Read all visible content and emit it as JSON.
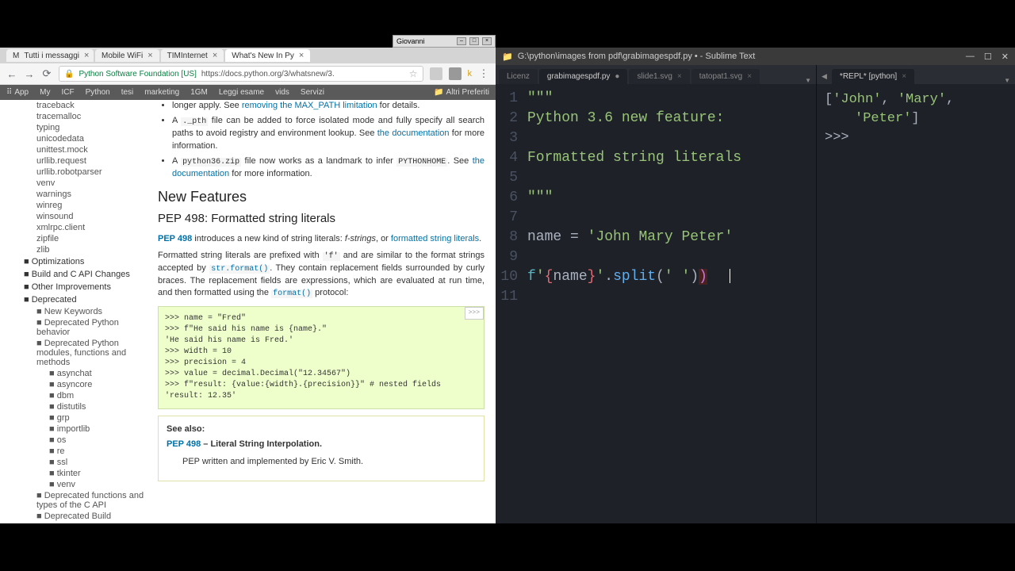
{
  "os_window": {
    "title": "Giovanni"
  },
  "chrome": {
    "tabs": [
      {
        "label": "Tutti i messaggi"
      },
      {
        "label": "Mobile WiFi"
      },
      {
        "label": "TIMInternet"
      },
      {
        "label": "What's New In Py"
      }
    ],
    "url_org": "Python Software Foundation [US]",
    "url_path": "https://docs.python.org/3/whatsnew/3.",
    "bookmarks": [
      "App",
      "My",
      "ICF",
      "Python",
      "tesi",
      "marketing",
      "1GM",
      "Leggi esame",
      "vids",
      "Servizi"
    ],
    "bookmarks_right": "Altri Preferiti"
  },
  "doc": {
    "sidebar_items": [
      "traceback",
      "tracemalloc",
      "typing",
      "unicodedata",
      "unittest.mock",
      "urllib.request",
      "urllib.robotparser",
      "venv",
      "warnings",
      "winreg",
      "winsound",
      "xmlrpc.client",
      "zipfile",
      "zlib"
    ],
    "sidebar_sections": [
      "Optimizations",
      "Build and C API Changes",
      "Other Improvements",
      "Deprecated"
    ],
    "dep_items": [
      "New Keywords",
      "Deprecated Python behavior",
      "Deprecated Python modules, functions and methods"
    ],
    "dep_sub": [
      "asynchat",
      "asyncore",
      "dbm",
      "distutils",
      "grp",
      "importlib",
      "os",
      "re",
      "ssl",
      "tkinter",
      "venv"
    ],
    "dep_tail": [
      "Deprecated functions and types of the C API",
      "Deprecated Build"
    ],
    "intro_li1_pre": "longer apply. See ",
    "intro_li1_link": "removing the MAX_PATH limitation",
    "intro_li1_post": " for details.",
    "intro_li2_a": "A ",
    "intro_li2_code": "._pth",
    "intro_li2_b": " file can be added to force isolated mode and fully specify all search paths to avoid registry and environment lookup. See ",
    "intro_li2_link": "the documentation",
    "intro_li2_c": " for more information.",
    "intro_li3_a": "A ",
    "intro_li3_code": "python36.zip",
    "intro_li3_b": " file now works as a landmark to infer ",
    "intro_li3_code2": "PYTHONHOME",
    "intro_li3_c": ". See ",
    "intro_li3_link": "the documentation",
    "intro_li3_d": " for more information.",
    "h2": "New Features",
    "h3": "PEP 498: Formatted string literals",
    "p1_link": "PEP 498",
    "p1_a": " introduces a new kind of string literals: ",
    "p1_i": "f-strings",
    "p1_b": ", or ",
    "p1_link2": "formatted string literals",
    "p1_c": ".",
    "p2_a": "Formatted string literals are prefixed with ",
    "p2_code1": "'f'",
    "p2_b": " and are similar to the format strings accepted by ",
    "p2_code2": "str.format()",
    "p2_c": ". They contain replacement fields surrounded by curly braces. The replacement fields are expressions, which are evaluated at run time, and then formatted using the ",
    "p2_code3": "format()",
    "p2_d": " protocol:",
    "code_copy": ">>>",
    "code_l1": ">>> name = \"Fred\"",
    "code_l2": ">>> f\"He said his name is {name}.\"",
    "code_l3": "'He said his name is Fred.'",
    "code_l4": ">>> width = 10",
    "code_l5": ">>> precision = 4",
    "code_l6": ">>> value = decimal.Decimal(\"12.34567\")",
    "code_l7": ">>> f\"result: {value:{width}.{precision}}\"  # nested fields",
    "code_l8": "'result:      12.35'",
    "seealso_title": "See also:",
    "seealso_link": "PEP 498",
    "seealso_bold": " – Literal String Interpolation.",
    "seealso_body": "PEP written and implemented by Eric V. Smith."
  },
  "sublime": {
    "title": "G:\\python\\images from pdf\\grabimagespdf.py • - Sublime Text",
    "left_tabs": [
      "Licenz",
      "grabimagespdf.py",
      "slide1.svg",
      "tatopat1.svg"
    ],
    "left_active": 1,
    "right_tab": "*REPL* [python]",
    "lines": {
      "1": "\"\"\"",
      "2": "Python 3.6 new feature:",
      "4": "Formatted string literals",
      "6": "\"\"\"",
      "8_a": "name ",
      "8_b": "=",
      "8_c": " 'John Mary Peter'",
      "10_f": "f",
      "10_s1": "'",
      "10_br1": "{",
      "10_name": "name",
      "10_br2": "}",
      "10_s2": "'",
      "10_dot": ".",
      "10_func": "split",
      "10_p1": "(",
      "10_arg": "' '",
      "10_p2": ")",
      "10_p3": ")"
    },
    "repl": {
      "out_open": "[",
      "out_s1": "'John'",
      "out_c1": ", ",
      "out_s2": "'Mary'",
      "out_c2": ", ",
      "out_s3": "'Peter'",
      "out_close": "]",
      "prompt": ">>> "
    }
  }
}
